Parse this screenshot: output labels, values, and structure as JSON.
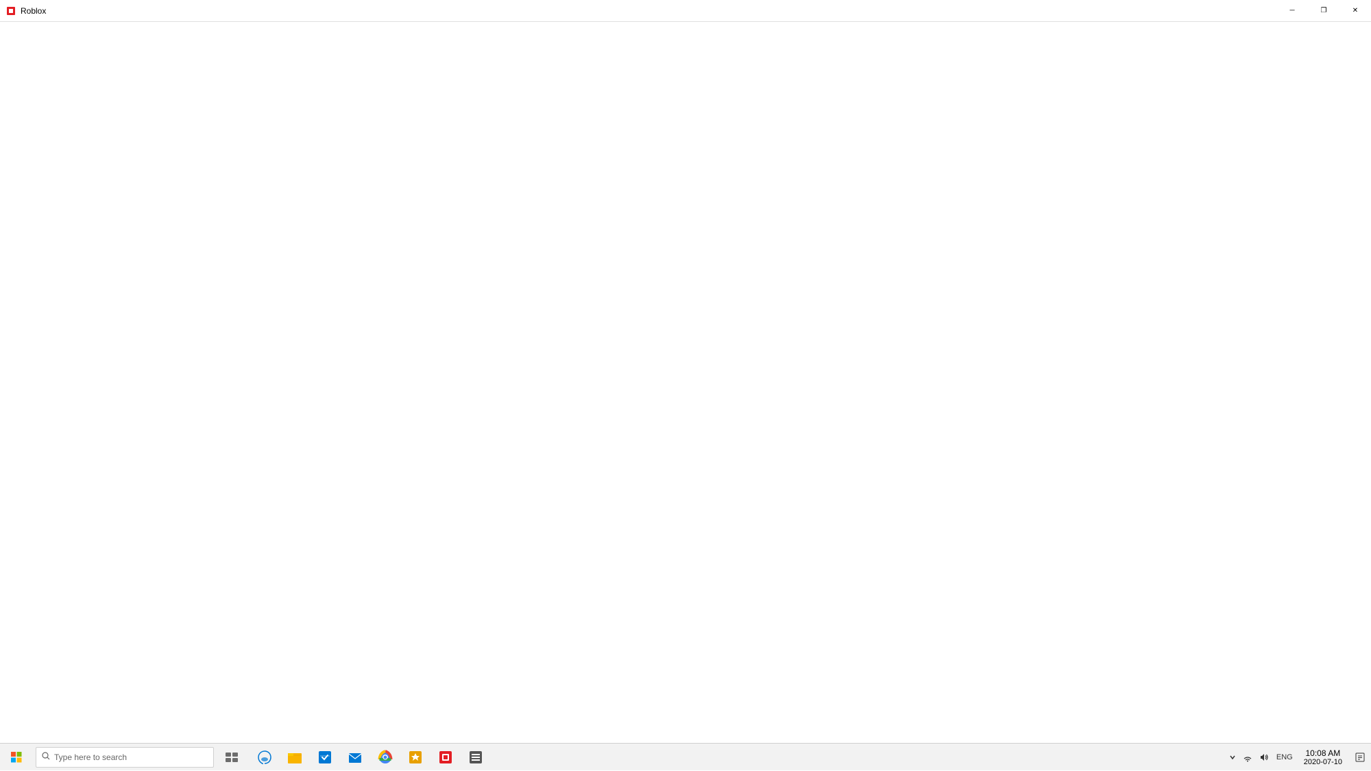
{
  "titlebar": {
    "app_name": "Roblox",
    "minimize_label": "─",
    "restore_label": "❐",
    "close_label": "✕"
  },
  "main": {
    "background_color": "#ffffff"
  },
  "taskbar": {
    "search_placeholder": "Type here to search",
    "search_text": "Type here to search",
    "language": "ENG",
    "clock": {
      "time": "10:08 AM",
      "date": "2020-07-10"
    },
    "apps": [
      {
        "name": "edge",
        "label": "Microsoft Edge",
        "color": "#0078d4"
      },
      {
        "name": "file-explorer",
        "label": "File Explorer",
        "color": "#f9b400"
      },
      {
        "name": "store",
        "label": "Microsoft Store",
        "color": "#0078d4"
      },
      {
        "name": "mail",
        "label": "Mail",
        "color": "#0078d4"
      },
      {
        "name": "chrome",
        "label": "Google Chrome",
        "color": "#4285f4"
      },
      {
        "name": "bookmarks",
        "label": "Bookmarks",
        "color": "#e8a000"
      },
      {
        "name": "roblox",
        "label": "Roblox",
        "color": "#e31e24"
      },
      {
        "name": "app8",
        "label": "App",
        "color": "#555"
      }
    ],
    "tray": {
      "chevron": "^",
      "network_icon": "wifi",
      "speaker_icon": "speaker",
      "notification_icon": "notification"
    }
  }
}
